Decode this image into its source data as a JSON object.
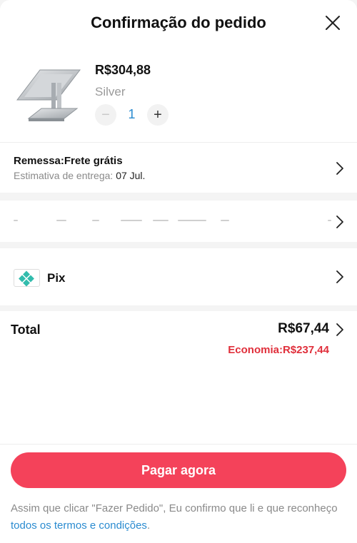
{
  "header": {
    "title": "Confirmação do pedido",
    "close_icon": "close-icon"
  },
  "product": {
    "image": "laptop-stand-image",
    "price": "R$304,88",
    "variant": "Silver",
    "quantity": "1",
    "minus_symbol": "−",
    "plus_symbol": "+"
  },
  "shipping": {
    "label": "Remessa:Frete grátis",
    "estimate_label": "Estimativa de entrega:",
    "estimate_date": "07 Jul."
  },
  "payment": {
    "method": "Pix",
    "icon": "pix-icon"
  },
  "summary": {
    "total_label": "Total",
    "total_value": "R$67,44",
    "savings": "Economia:R$237,44"
  },
  "actions": {
    "pay_button": "Pagar agora"
  },
  "terms": {
    "text_before": "Assim que clicar \"Fazer Pedido\", Eu confirmo que li e que reconheço",
    "link": "todos os termos e condições",
    "text_after": "."
  },
  "colors": {
    "accent": "#f4425a",
    "link": "#2a8bd0",
    "savings": "#e02f3b",
    "pix": "#32bcad"
  }
}
